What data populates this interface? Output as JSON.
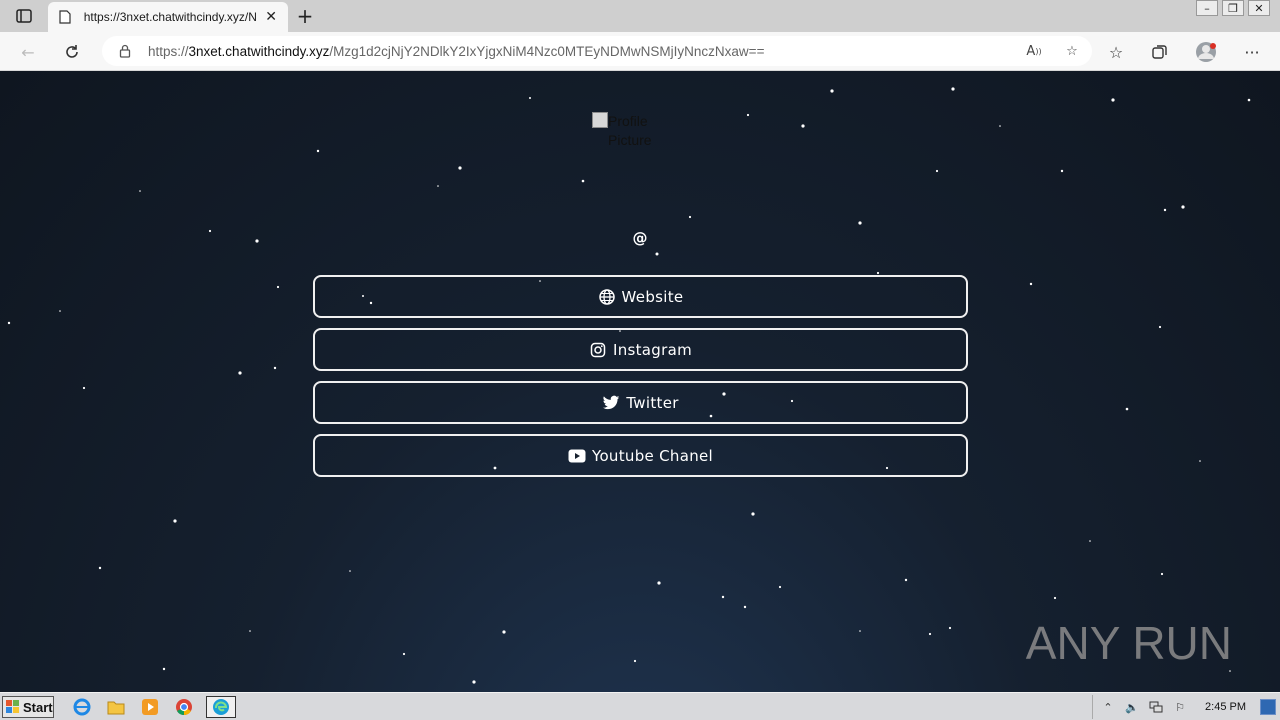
{
  "browser": {
    "tab": {
      "title": "https://3nxet.chatwithcindy.xyz/N",
      "favicon": "page-icon"
    },
    "address": {
      "url_prefix": "https://",
      "url_host": "3nxet.chatwithcindy.xyz",
      "url_path": "/Mzg1d2cjNjY2NDlkY2IxYjgxNiM4Nzc0MTEyNDMwNSMjIyNnczNxaw=="
    }
  },
  "page": {
    "profile_alt_text": "Profile Picture",
    "handle": "@",
    "links": [
      {
        "label": "Website",
        "icon": "globe-icon"
      },
      {
        "label": "Instagram",
        "icon": "instagram-icon"
      },
      {
        "label": "Twitter",
        "icon": "twitter-icon"
      },
      {
        "label": "Youtube Chanel",
        "icon": "youtube-icon"
      }
    ],
    "watermark": "ANY RUN"
  },
  "taskbar": {
    "start_label": "Start",
    "clock": "2:45 PM"
  }
}
